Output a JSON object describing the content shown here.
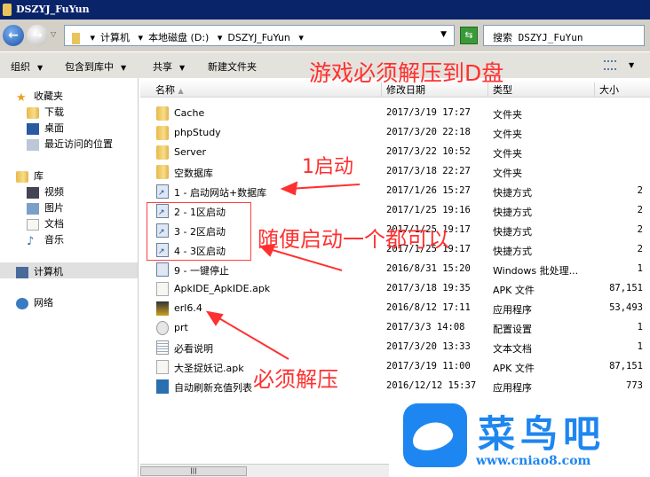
{
  "window": {
    "title": "DSZYJ_FuYun"
  },
  "address": {
    "crumbs": [
      "计算机",
      "本地磁盘 (D:)",
      "DSZYJ_FuYun"
    ],
    "search_placeholder": "搜索 DSZYJ_FuYun"
  },
  "toolbar": {
    "organize": "组织",
    "include_library": "包含到库中",
    "share": "共享",
    "new_folder": "新建文件夹"
  },
  "sidebar": {
    "favorites": "收藏夹",
    "downloads": "下载",
    "desktop": "桌面",
    "recent": "最近访问的位置",
    "libraries": "库",
    "videos": "视频",
    "pictures": "图片",
    "documents": "文档",
    "music": "音乐",
    "computer": "计算机",
    "network": "网络"
  },
  "columns": {
    "name": "名称",
    "date": "修改日期",
    "type": "类型",
    "size": "大小"
  },
  "files": [
    {
      "name": "Cache",
      "date": "2017/3/19 17:27",
      "type": "文件夹",
      "size": "",
      "icon": "folder"
    },
    {
      "name": "phpStudy",
      "date": "2017/3/20 22:18",
      "type": "文件夹",
      "size": "",
      "icon": "folder"
    },
    {
      "name": "Server",
      "date": "2017/3/22 10:52",
      "type": "文件夹",
      "size": "",
      "icon": "folder"
    },
    {
      "name": "空数据库",
      "date": "2017/3/18 22:27",
      "type": "文件夹",
      "size": "",
      "icon": "folder"
    },
    {
      "name": "1 - 启动网站+数据库",
      "date": "2017/1/26 15:27",
      "type": "快捷方式",
      "size": "2",
      "icon": "shortcut"
    },
    {
      "name": "2 - 1区启动",
      "date": "2017/1/25 19:16",
      "type": "快捷方式",
      "size": "2",
      "icon": "shortcut"
    },
    {
      "name": "3 - 2区启动",
      "date": "2017/1/25 19:17",
      "type": "快捷方式",
      "size": "2",
      "icon": "shortcut"
    },
    {
      "name": "4 - 3区启动",
      "date": "2017/1/25 19:17",
      "type": "快捷方式",
      "size": "2",
      "icon": "shortcut"
    },
    {
      "name": "9 - 一键停止",
      "date": "2016/8/31 15:20",
      "type": "Windows 批处理...",
      "size": "1",
      "icon": "bat"
    },
    {
      "name": "ApkIDE_ApkIDE.apk",
      "date": "2017/3/18 19:35",
      "type": "APK 文件",
      "size": "87,151",
      "icon": "file"
    },
    {
      "name": "erl6.4",
      "date": "2016/8/12 17:11",
      "type": "应用程序",
      "size": "53,493",
      "icon": "exe"
    },
    {
      "name": "prt",
      "date": "2017/3/3 14:08",
      "type": "配置设置",
      "size": "1",
      "icon": "cfg"
    },
    {
      "name": "必看说明",
      "date": "2017/3/20 13:33",
      "type": "文本文档",
      "size": "1",
      "icon": "txt"
    },
    {
      "name": "大圣捉妖记.apk",
      "date": "2017/3/19 11:00",
      "type": "APK 文件",
      "size": "87,151",
      "icon": "file"
    },
    {
      "name": "自动刷新充值列表",
      "date": "2016/12/12 15:37",
      "type": "应用程序",
      "size": "773",
      "icon": "app"
    }
  ],
  "annotations": {
    "top": "游戏必须解压到D盘",
    "start1": "1启动",
    "any": "随便启动一个都可以",
    "extract": "必须解压"
  },
  "watermark": {
    "title": "菜鸟吧",
    "url": "www.cniao8.com"
  },
  "colors": {
    "titlebar": "#0a246a",
    "annotation": "#ff3030",
    "watermark": "#1e86f0"
  }
}
